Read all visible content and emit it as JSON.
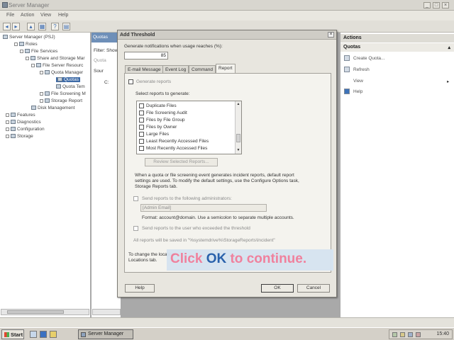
{
  "window": {
    "title": "Server Manager",
    "min": "_",
    "max": "□",
    "close": "×"
  },
  "menu": {
    "file": "File",
    "action": "Action",
    "view": "View",
    "help": "Help"
  },
  "tree": {
    "items": [
      "Server Manager (PSJ)",
      "Roles",
      "File Services",
      "Share and Storage Mar",
      "File Server Resourc",
      "Quota Manager",
      "Quotas",
      "Quota Tem",
      "File Screening M",
      "Storage Report",
      "Disk Management",
      "Features",
      "Diagnostics",
      "Configuration",
      "Storage"
    ]
  },
  "mid": {
    "header": "Quotas",
    "row1": "Filter: Show",
    "row2": "Quota",
    "row3": "Sour",
    "row4": "C:"
  },
  "actions": {
    "header": "Actions",
    "section": "Quotas",
    "items": [
      "Create Quota...",
      "Refresh",
      "View",
      "Help"
    ],
    "expand_arrow": "▴",
    "view_arrow": "▸"
  },
  "dialog": {
    "title": "Add Threshold",
    "close": "×",
    "notify_label": "Generate notifications when usage reaches (%):",
    "notify_value": "85",
    "tabs": [
      "E-mail Message",
      "Event Log",
      "Command",
      "Report"
    ],
    "active_tab": "Report",
    "generate_reports_label": "Generate reports",
    "select_reports_label": "Select reports to generate:",
    "reports": [
      "Duplicate Files",
      "File Screening Audit",
      "Files by File Group",
      "Files by Owner",
      "Large Files",
      "Least Recently Accessed Files",
      "Most Recently Accessed Files"
    ],
    "review_button": "Review Selected Reports...",
    "info_text_1": "When a quota or file screening event generates incident reports, default report",
    "info_text_2": "settings are used. To modify the default settings, use the Configure Options task,",
    "info_text_3": "Storage Reports tab.",
    "send_admin_label": "Send reports to the following administrators:",
    "admin_email_placeholder": "[Admin Email]",
    "format_text": "Format: account@domain. Use a semicolon to separate multiple accounts.",
    "send_user_label": "Send reports to the user who exceeded the threshold",
    "saved_text": "All reports will be saved in \"%systemdrive%\\StorageReports\\Incident\"",
    "locations_text_1": "To change the location",
    "locations_text_2": "Locations tab.",
    "help_button": "Help",
    "ok_button": "OK",
    "cancel_button": "Cancel"
  },
  "callout": {
    "pre": "Click ",
    "ok": "OK",
    "post": " to continue."
  },
  "taskbar": {
    "start": "Start",
    "task": "Server Manager",
    "clock": "15:40"
  }
}
